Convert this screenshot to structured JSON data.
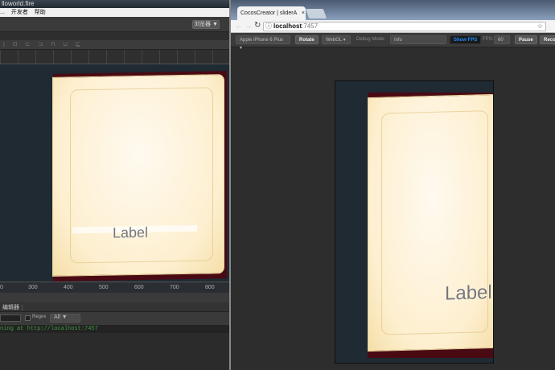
{
  "editor": {
    "title": "lloworld.fire",
    "menu": [
      "...",
      "开发者",
      "帮助"
    ],
    "preview_button": "浏览器 ▼",
    "toolbar_icons": "| ⊡ ⊏ ⊐ ⊓ ⊔ ⊑",
    "axis_ticks": [
      "0",
      "300",
      "400",
      "500",
      "600",
      "700",
      "800"
    ],
    "scene_label": "Label",
    "panel_tab": "编辑器",
    "filter": {
      "regex_label": "Regex",
      "level": "All ▼"
    },
    "log_line": "ning at http://localhost:7457"
  },
  "browser": {
    "tab_title": "CocosCreator | sliderA",
    "tab_close": "×",
    "url_host": "localhost",
    "url_port": ":7457",
    "toolbar": {
      "device": "Apple iPhone 6 Plus ▾",
      "rotate": "Rotate",
      "renderer": "WebGL ▾",
      "debug_label": "Debug Mode:",
      "debug_value": "Info",
      "show_fps": "Show FPS",
      "fps_label": "FPS:",
      "fps_value": "60",
      "pause": "Pause",
      "recompile": "Recom"
    },
    "game_label": "Label"
  },
  "colors": {
    "accent": "#1e8bff",
    "log_green": "#3b9a3b"
  }
}
